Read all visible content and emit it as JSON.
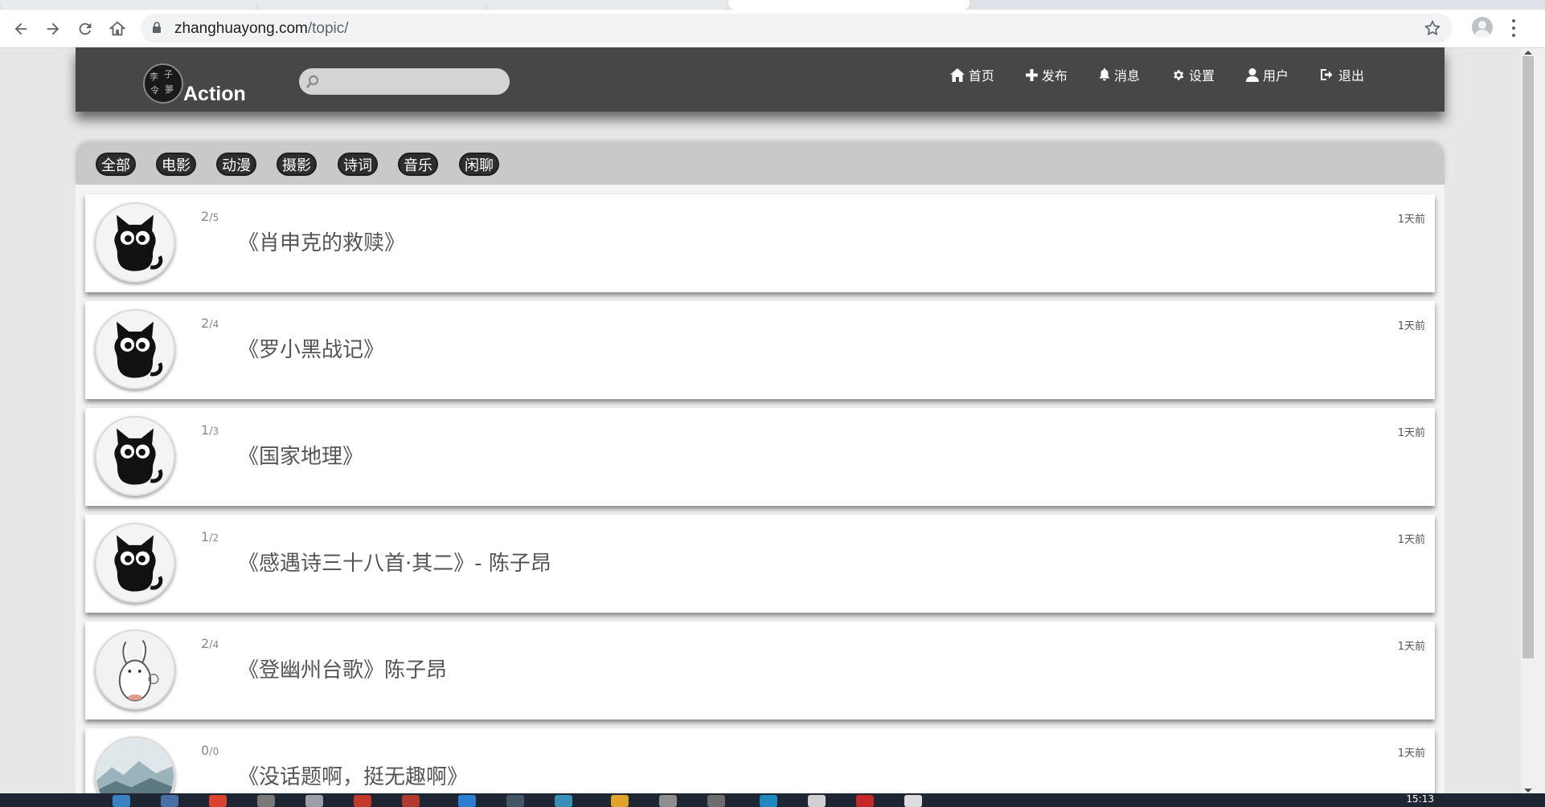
{
  "browser": {
    "url_host": "zhanghuayong.com",
    "url_path": "/topic/"
  },
  "site": {
    "logo_text": "Action",
    "logo_glyphs": [
      "李",
      "子",
      "令",
      "夢"
    ],
    "search_placeholder": "",
    "nav": [
      {
        "label": "首页",
        "icon": "home-icon"
      },
      {
        "label": "发布",
        "icon": "plus-icon"
      },
      {
        "label": "消息",
        "icon": "bell-icon"
      },
      {
        "label": "设置",
        "icon": "gear-icon"
      },
      {
        "label": "用户",
        "icon": "user-icon"
      },
      {
        "label": "退出",
        "icon": "logout-icon"
      }
    ]
  },
  "categories": [
    "全部",
    "电影",
    "动漫",
    "摄影",
    "诗词",
    "音乐",
    "闲聊"
  ],
  "topics": [
    {
      "title": "《肖申克的救赎》",
      "count": "2",
      "total": "5",
      "time": "1天前",
      "avatar": "black-cat"
    },
    {
      "title": "《罗小黑战记》",
      "count": "2",
      "total": "4",
      "time": "1天前",
      "avatar": "black-cat"
    },
    {
      "title": "《国家地理》",
      "count": "1",
      "total": "3",
      "time": "1天前",
      "avatar": "black-cat"
    },
    {
      "title": "《感遇诗三十八首·其二》- 陈子昂",
      "count": "1",
      "total": "2",
      "time": "1天前",
      "avatar": "black-cat"
    },
    {
      "title": "《登幽州台歌》陈子昂",
      "count": "2",
      "total": "4",
      "time": "1天前",
      "avatar": "rabbit"
    },
    {
      "title": "《没话题啊，挺无趣啊》",
      "count": "0",
      "total": "0",
      "time": "1天前",
      "avatar": "landscape"
    }
  ],
  "taskbar": {
    "clock": "15:13"
  }
}
